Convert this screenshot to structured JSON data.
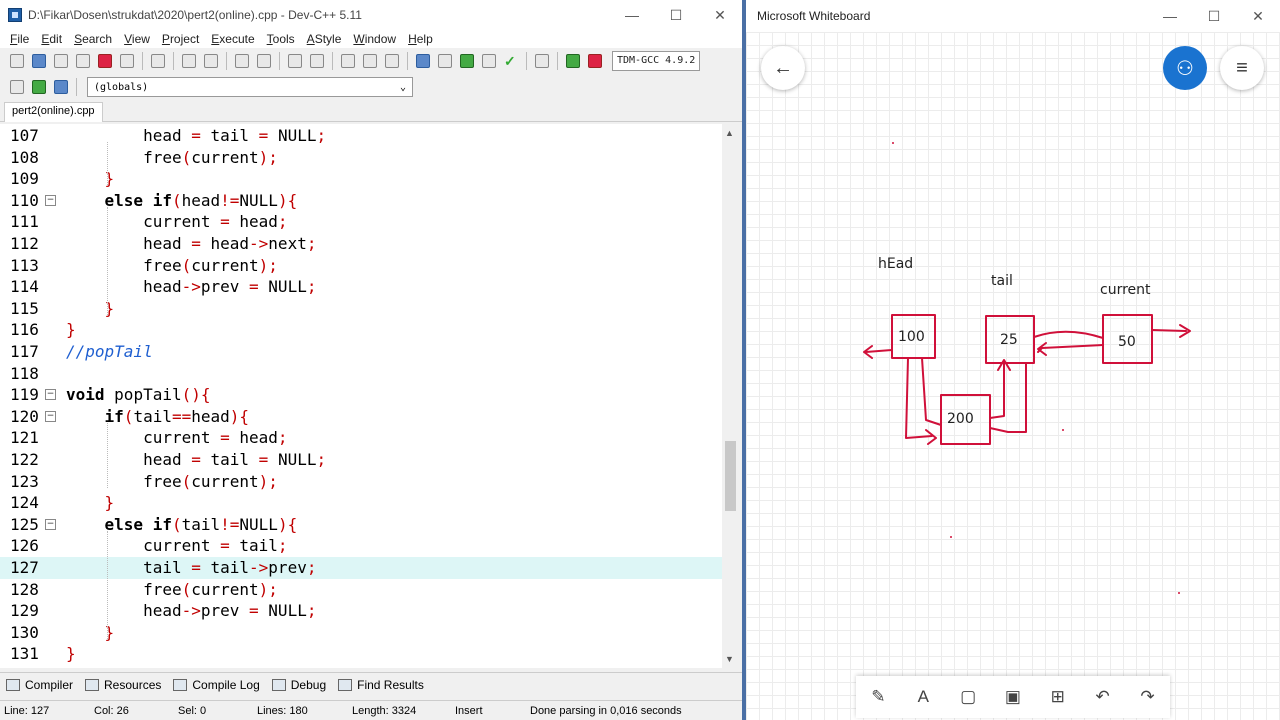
{
  "devcpp": {
    "title": "D:\\Fikar\\Dosen\\strukdat\\2020\\pert2(online).cpp - Dev-C++ 5.11",
    "menu": [
      "File",
      "Edit",
      "Search",
      "View",
      "Project",
      "Execute",
      "Tools",
      "AStyle",
      "Window",
      "Help"
    ],
    "compiler": "TDM-GCC 4.9.2",
    "scope": "(globals)",
    "tab": "pert2(online).cpp",
    "lines": [
      {
        "n": "107",
        "fold": "",
        "code": [
          [
            "        ",
            ""
          ],
          [
            "head ",
            ""
          ],
          [
            "= ",
            "sy"
          ],
          [
            "tail ",
            ""
          ],
          [
            "= ",
            "sy"
          ],
          [
            "NULL",
            ""
          ],
          [
            ";",
            "sy"
          ]
        ]
      },
      {
        "n": "108",
        "fold": "",
        "code": [
          [
            "        ",
            ""
          ],
          [
            "free",
            ""
          ],
          [
            "(",
            "sy"
          ],
          [
            "current",
            ""
          ],
          [
            ");",
            "sy"
          ]
        ]
      },
      {
        "n": "109",
        "fold": "",
        "code": [
          [
            "    ",
            ""
          ],
          [
            "}",
            "sy"
          ]
        ]
      },
      {
        "n": "110",
        "fold": "−",
        "code": [
          [
            "    ",
            ""
          ],
          [
            "else if",
            "kw"
          ],
          [
            "(",
            "sy"
          ],
          [
            "head",
            ""
          ],
          [
            "!=",
            "sy"
          ],
          [
            "NULL",
            ""
          ],
          [
            "){",
            "sy"
          ]
        ]
      },
      {
        "n": "111",
        "fold": "",
        "code": [
          [
            "        ",
            ""
          ],
          [
            "current ",
            ""
          ],
          [
            "= ",
            "sy"
          ],
          [
            "head",
            ""
          ],
          [
            ";",
            "sy"
          ]
        ]
      },
      {
        "n": "112",
        "fold": "",
        "code": [
          [
            "        ",
            ""
          ],
          [
            "head ",
            ""
          ],
          [
            "= ",
            "sy"
          ],
          [
            "head",
            ""
          ],
          [
            "->",
            "sy"
          ],
          [
            "next",
            ""
          ],
          [
            ";",
            "sy"
          ]
        ]
      },
      {
        "n": "113",
        "fold": "",
        "code": [
          [
            "        ",
            ""
          ],
          [
            "free",
            ""
          ],
          [
            "(",
            "sy"
          ],
          [
            "current",
            ""
          ],
          [
            ");",
            "sy"
          ]
        ]
      },
      {
        "n": "114",
        "fold": "",
        "code": [
          [
            "        ",
            ""
          ],
          [
            "head",
            ""
          ],
          [
            "->",
            "sy"
          ],
          [
            "prev ",
            ""
          ],
          [
            "= ",
            "sy"
          ],
          [
            "NULL",
            ""
          ],
          [
            ";",
            "sy"
          ]
        ]
      },
      {
        "n": "115",
        "fold": "",
        "code": [
          [
            "    ",
            ""
          ],
          [
            "}",
            "sy"
          ]
        ]
      },
      {
        "n": "116",
        "fold": "",
        "code": [
          [
            "}",
            "sy"
          ]
        ]
      },
      {
        "n": "117",
        "fold": "",
        "code": [
          [
            "//popTail",
            "cm"
          ]
        ]
      },
      {
        "n": "118",
        "fold": "",
        "code": []
      },
      {
        "n": "119",
        "fold": "−",
        "code": [
          [
            "void ",
            "kw"
          ],
          [
            "popTail",
            ""
          ],
          [
            "(){",
            "sy"
          ]
        ]
      },
      {
        "n": "120",
        "fold": "−",
        "code": [
          [
            "    ",
            ""
          ],
          [
            "if",
            "kw"
          ],
          [
            "(",
            "sy"
          ],
          [
            "tail",
            ""
          ],
          [
            "==",
            "sy"
          ],
          [
            "head",
            ""
          ],
          [
            "){",
            "sy"
          ]
        ]
      },
      {
        "n": "121",
        "fold": "",
        "code": [
          [
            "        ",
            ""
          ],
          [
            "current ",
            ""
          ],
          [
            "= ",
            "sy"
          ],
          [
            "head",
            ""
          ],
          [
            ";",
            "sy"
          ]
        ]
      },
      {
        "n": "122",
        "fold": "",
        "code": [
          [
            "        ",
            ""
          ],
          [
            "head ",
            ""
          ],
          [
            "= ",
            "sy"
          ],
          [
            "tail ",
            ""
          ],
          [
            "= ",
            "sy"
          ],
          [
            "NULL",
            ""
          ],
          [
            ";",
            "sy"
          ]
        ]
      },
      {
        "n": "123",
        "fold": "",
        "code": [
          [
            "        ",
            ""
          ],
          [
            "free",
            ""
          ],
          [
            "(",
            "sy"
          ],
          [
            "current",
            ""
          ],
          [
            ");",
            "sy"
          ]
        ]
      },
      {
        "n": "124",
        "fold": "",
        "code": [
          [
            "    ",
            ""
          ],
          [
            "}",
            "sy"
          ]
        ]
      },
      {
        "n": "125",
        "fold": "−",
        "code": [
          [
            "    ",
            ""
          ],
          [
            "else if",
            "kw"
          ],
          [
            "(",
            "sy"
          ],
          [
            "tail",
            ""
          ],
          [
            "!=",
            "sy"
          ],
          [
            "NULL",
            ""
          ],
          [
            "){",
            "sy"
          ]
        ]
      },
      {
        "n": "126",
        "fold": "",
        "code": [
          [
            "        ",
            ""
          ],
          [
            "current ",
            ""
          ],
          [
            "= ",
            "sy"
          ],
          [
            "tail",
            ""
          ],
          [
            ";",
            "sy"
          ]
        ]
      },
      {
        "n": "127",
        "fold": "",
        "hl": true,
        "code": [
          [
            "        ",
            ""
          ],
          [
            "tail ",
            ""
          ],
          [
            "= ",
            "sy"
          ],
          [
            "tail",
            ""
          ],
          [
            "->",
            "sy"
          ],
          [
            "prev",
            ""
          ],
          [
            ";",
            "sy"
          ]
        ]
      },
      {
        "n": "128",
        "fold": "",
        "code": [
          [
            "        ",
            ""
          ],
          [
            "free",
            ""
          ],
          [
            "(",
            "sy"
          ],
          [
            "current",
            ""
          ],
          [
            ");",
            "sy"
          ]
        ]
      },
      {
        "n": "129",
        "fold": "",
        "code": [
          [
            "        ",
            ""
          ],
          [
            "head",
            ""
          ],
          [
            "->",
            "sy"
          ],
          [
            "prev ",
            ""
          ],
          [
            "= ",
            "sy"
          ],
          [
            "NULL",
            ""
          ],
          [
            ";",
            "sy"
          ]
        ]
      },
      {
        "n": "130",
        "fold": "",
        "code": [
          [
            "    ",
            ""
          ],
          [
            "}",
            "sy"
          ]
        ]
      },
      {
        "n": "131",
        "fold": "",
        "code": [
          [
            "}",
            "sy"
          ]
        ]
      }
    ],
    "bottom_tabs": [
      "Compiler",
      "Resources",
      "Compile Log",
      "Debug",
      "Find Results"
    ],
    "status": {
      "line": "Line:   127",
      "col": "Col:   26",
      "sel": "Sel:   0",
      "lines": "Lines:   180",
      "length": "Length:   3324",
      "mode": "Insert",
      "msg": "Done parsing in 0,016 seconds"
    }
  },
  "whiteboard": {
    "title": "Microsoft Whiteboard",
    "labels": {
      "head": "hEad",
      "tail": "tail",
      "current": "current"
    },
    "nodes": {
      "n1": "100",
      "n2": "25",
      "n3": "50",
      "n4": "200"
    },
    "ink_color": "#d0103a",
    "tools": [
      "pen-icon",
      "text-icon",
      "sticky-note-icon",
      "image-icon",
      "insert-icon",
      "undo-icon",
      "redo-icon"
    ]
  }
}
